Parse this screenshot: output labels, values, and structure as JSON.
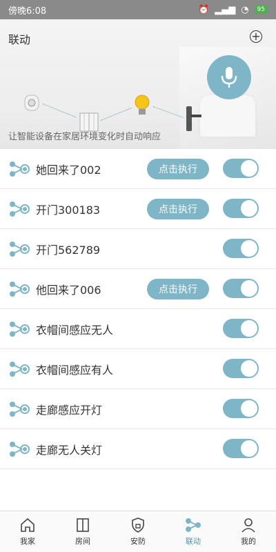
{
  "status_bar": {
    "time": "傍晚6:08",
    "battery": "95"
  },
  "header": {
    "title": "联动",
    "add_icon": "plus-circle-icon"
  },
  "banner": {
    "subtitle": "让智能设备在家居环境变化时自动响应",
    "mic_icon": "microphone-icon",
    "accent": "#7fb6c7"
  },
  "linkages": [
    {
      "name": "她回来了002",
      "exec_label": "点击执行",
      "enabled": true
    },
    {
      "name": "开门300183",
      "exec_label": "点击执行",
      "enabled": true
    },
    {
      "name": "开门562789",
      "exec_label": "",
      "enabled": true
    },
    {
      "name": "他回来了006",
      "exec_label": "点击执行",
      "enabled": true
    },
    {
      "name": "衣帽间感应无人",
      "exec_label": "",
      "enabled": true
    },
    {
      "name": "衣帽间感应有人",
      "exec_label": "",
      "enabled": true
    },
    {
      "name": "走廊感应开灯",
      "exec_label": "",
      "enabled": true
    },
    {
      "name": "走廊无人关灯",
      "exec_label": "",
      "enabled": true
    }
  ],
  "tabs": [
    {
      "label": "我家",
      "icon": "home-icon",
      "active": false
    },
    {
      "label": "房间",
      "icon": "room-icon",
      "active": false
    },
    {
      "label": "安防",
      "icon": "security-icon",
      "active": false
    },
    {
      "label": "联动",
      "icon": "linkage-icon",
      "active": true
    },
    {
      "label": "我的",
      "icon": "profile-icon",
      "active": false
    }
  ]
}
